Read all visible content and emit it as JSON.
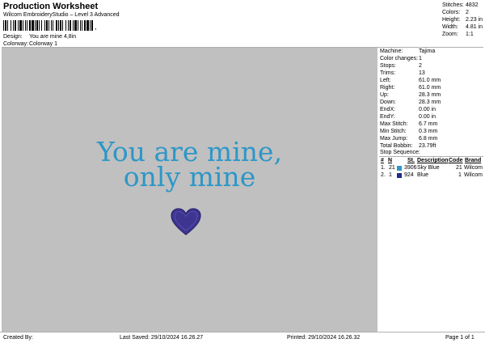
{
  "header": {
    "title": "Production Worksheet",
    "subtitle": "Wilcom EmbroideryStudio – Level 3 Advanced",
    "barcode_suffix": ","
  },
  "design_info": [
    {
      "label": "Design:",
      "value": "You are mine 4,8in"
    },
    {
      "label": "Colorway:",
      "value": "Colorway 1"
    }
  ],
  "summary": [
    {
      "label": "Stitches:",
      "value": "4832"
    },
    {
      "label": "Colors:",
      "value": "2"
    },
    {
      "label": "Height:",
      "value": "2.23 in"
    },
    {
      "label": "Width:",
      "value": "4.81 in"
    },
    {
      "label": "Zoom:",
      "value": "1:1"
    }
  ],
  "design": {
    "line1": "You are mine,",
    "line2": "only mine",
    "text_color": "#2d97c7",
    "heart_color": "#3d3590",
    "background": "#c0c0c0"
  },
  "machine_info": [
    {
      "label": "Machine:",
      "value": "Tajima"
    },
    {
      "label": "Color changes:",
      "value": "1"
    },
    {
      "label": "Stops:",
      "value": "2"
    },
    {
      "label": "Trims:",
      "value": "13"
    },
    {
      "label": "Left:",
      "value": "61.0 mm"
    },
    {
      "label": "Right:",
      "value": "61.0 mm"
    },
    {
      "label": "Up:",
      "value": "28.3 mm"
    },
    {
      "label": "Down:",
      "value": "28.3 mm"
    },
    {
      "label": "EndX:",
      "value": "0.00 in"
    },
    {
      "label": "EndY:",
      "value": "0.00 in"
    },
    {
      "label": "Max Stitch:",
      "value": "6.7 mm"
    },
    {
      "label": "Min Stitch:",
      "value": "0.3 mm"
    },
    {
      "label": "Max Jump:",
      "value": "6.8 mm"
    },
    {
      "label": "Total Bobbin:",
      "value": "23.79ft"
    }
  ],
  "stop_sequence": {
    "title": "Stop Sequence:",
    "columns": [
      "#",
      "N",
      "St.",
      "Description",
      "Code",
      "Brand"
    ],
    "rows": [
      {
        "num": "1.",
        "n": "21",
        "st": "3906",
        "description": "Sky Blue",
        "code": "21",
        "brand": "Wilcom",
        "color": "#2d97c7"
      },
      {
        "num": "2.",
        "n": "1",
        "st": "924",
        "description": "Blue",
        "code": "1",
        "brand": "Wilcom",
        "color": "#1e2b8a"
      }
    ]
  },
  "footer": {
    "created_by": "Created By:",
    "last_saved": "Last Saved: 29/10/2024 16.26.27",
    "printed": "Printed: 29/10/2024 16.26.32",
    "page": "Page 1 of 1"
  }
}
